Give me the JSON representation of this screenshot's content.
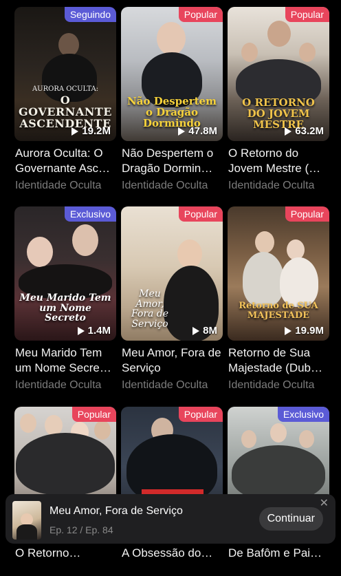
{
  "cards": [
    {
      "badge": "Seguindo",
      "badge_color": "#5b5bd6",
      "overlay_sub": "AURORA OCULTA:",
      "overlay_title": "O GOVERNANTE ASCENDENTE",
      "plays": "19.2M",
      "title": "Aurora Oculta: O Governante Asc…",
      "tag": "Identidade Oculta"
    },
    {
      "badge": "Popular",
      "badge_color": "#e8455c",
      "overlay_title": "Não Despertem o Dragão Dormindo",
      "plays": "47.8M",
      "title": "Não Despertem o Dragão Dormin…",
      "tag": "Identidade Oculta"
    },
    {
      "badge": "Popular",
      "badge_color": "#e8455c",
      "overlay_title": "O RETORNO DO JOVEM MESTRE",
      "plays": "63.2M",
      "title": "O Retorno do Jovem Mestre (…",
      "tag": "Identidade Oculta"
    },
    {
      "badge": "Exclusivo",
      "badge_color": "#5b5bd6",
      "overlay_title": "Meu Marido Tem um Nome Secreto",
      "plays": "1.4M",
      "title": "Meu Marido Tem um Nome Secre…",
      "tag": "Identidade Oculta"
    },
    {
      "badge": "Popular",
      "badge_color": "#e8455c",
      "overlay_title": "Meu Amor, Fora de Serviço",
      "plays": "8M",
      "title": "Meu Amor, Fora de Serviço",
      "tag": "Identidade Oculta"
    },
    {
      "badge": "Popular",
      "badge_color": "#e8455c",
      "overlay_title": "Retorno de SUA MAJESTADE",
      "plays": "19.9M",
      "title": "Retorno de Sua Majestade (Dub…",
      "tag": "Identidade Oculta"
    },
    {
      "badge": "Popular",
      "badge_color": "#e8455c",
      "title": "O Retorno…"
    },
    {
      "badge": "Popular",
      "badge_color": "#e8455c",
      "title": "A Obsessão do…"
    },
    {
      "badge": "Exclusivo",
      "badge_color": "#5b5bd6",
      "title": "De Bafôm e Pai…"
    }
  ],
  "mini_player": {
    "title": "Meu Amor, Fora de Serviço",
    "episode": "Ep. 12 / Ep. 84",
    "continue_label": "Continuar",
    "close_glyph": "✕"
  },
  "icons": {
    "play": "play-icon",
    "close": "close-icon"
  }
}
